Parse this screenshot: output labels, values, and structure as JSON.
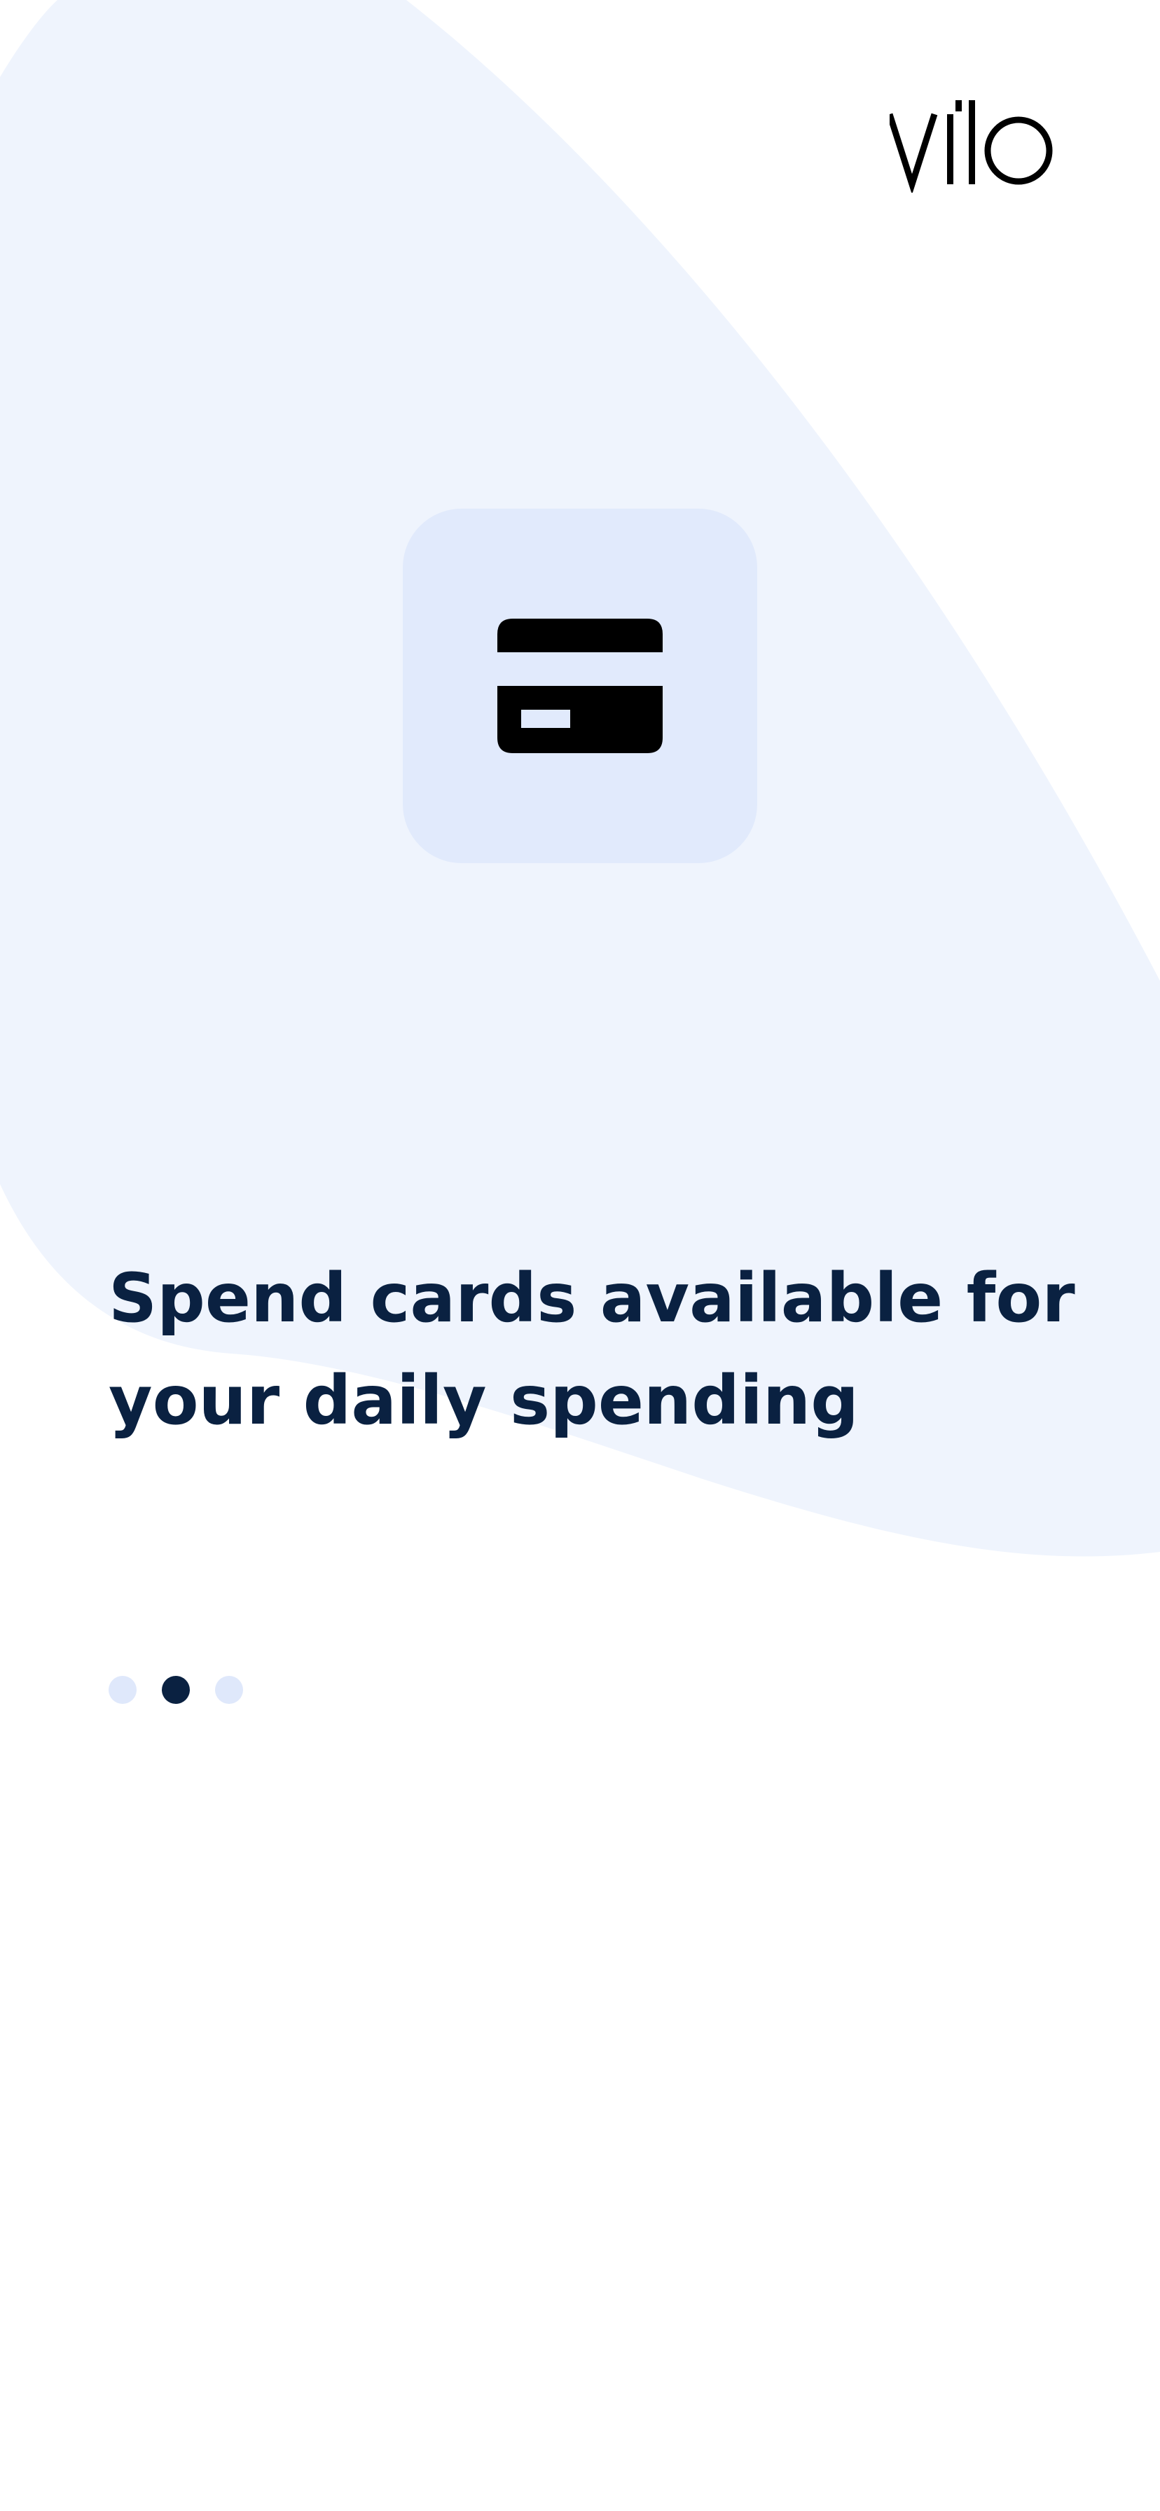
{
  "brand": {
    "logo_text": "vilo"
  },
  "slide": {
    "icon": "credit-card-icon",
    "headline_line1": "Spend cards available for",
    "headline_line2": "your daily spending"
  },
  "pager": {
    "total": 3,
    "active_index": 1
  },
  "colors": {
    "background": "#ffffff",
    "blob": "#eff4fd",
    "icon_tile": "#e1eafc",
    "headline": "#0a2141",
    "dot_inactive": "#dfe8fb",
    "dot_active": "#0a2141"
  }
}
